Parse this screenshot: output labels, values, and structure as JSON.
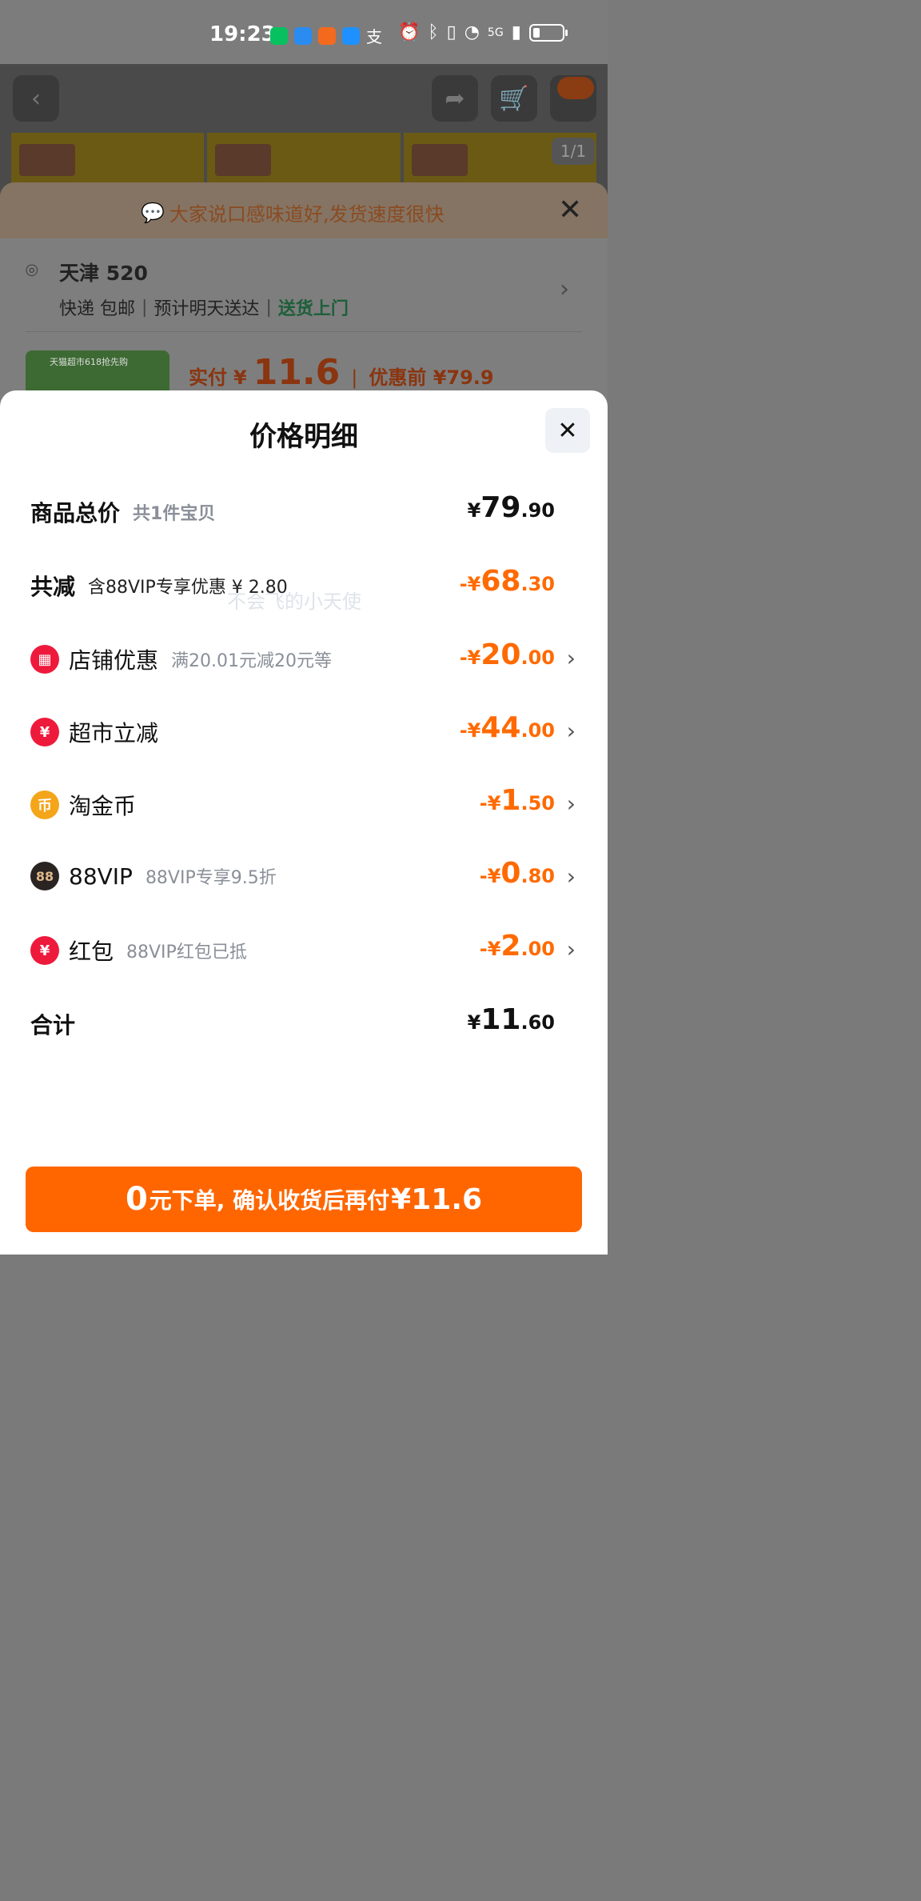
{
  "status_bar": {
    "time": "19:23",
    "network": "5G"
  },
  "background_page": {
    "image_counter": "1/1"
  },
  "checkout": {
    "banner": "大家说口感味道好,发货速度很快",
    "address": "天津 520",
    "shipping": [
      "快递 包邮",
      "预计明天送达"
    ],
    "shipping_highlight": "送货上门",
    "paid_label": "实付",
    "paid_symbol": "¥",
    "paid_value": "11.6",
    "before_label": "优惠前 ¥79.9",
    "product_tag": "天猫超市618抢先购"
  },
  "modal": {
    "title": "价格明细",
    "watermark": "不会飞的小天使",
    "rows": [
      {
        "label": "商品总价",
        "note": "共1件宝贝",
        "sign": "¥",
        "int": "79",
        "dec": ".90",
        "color": "#111111"
      },
      {
        "label": "共减",
        "note": "含88VIP专享优惠 ¥ 2.80",
        "sign": "-¥",
        "int": "68",
        "dec": ".30",
        "color": "#ff6a00"
      },
      {
        "label": "店铺优惠",
        "note": "满20.01元减20元等",
        "sign": "-¥",
        "int": "20",
        "dec": ".00",
        "icon": "store-icon"
      },
      {
        "label": "超市立减",
        "note": "",
        "sign": "-¥",
        "int": "44",
        "dec": ".00",
        "icon": "yuan-discount-icon"
      },
      {
        "label": "淘金币",
        "note": "",
        "sign": "-¥",
        "int": "1",
        "dec": ".50",
        "icon": "coin-icon"
      },
      {
        "label": "88VIP",
        "note": "88VIP专享9.5折",
        "sign": "-¥",
        "int": "0",
        "dec": ".80",
        "icon": "vip-88-icon"
      },
      {
        "label": "红包",
        "note": "88VIP红包已抵",
        "sign": "-¥",
        "int": "2",
        "dec": ".00",
        "icon": "red-packet-icon"
      },
      {
        "label": "合计",
        "note": "",
        "sign": "¥",
        "int": "11",
        "dec": ".60",
        "color": "#111111"
      }
    ],
    "cta": {
      "zero": "0",
      "text": "元下单, 确认收货后再付",
      "price": "¥11.6"
    }
  }
}
